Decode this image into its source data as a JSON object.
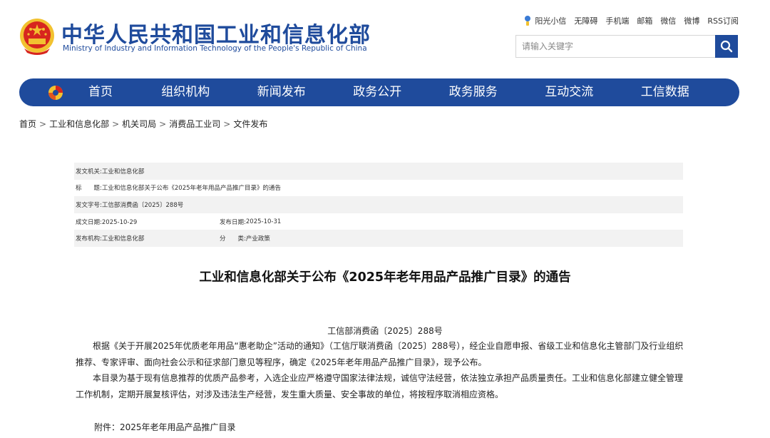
{
  "header": {
    "title": "中华人民共和国工业和信息化部",
    "subtitle": "Ministry of Industry and Information Technology of the People's Republic of China",
    "links": [
      "阳光小信",
      "无障碍",
      "手机端",
      "邮箱",
      "微信",
      "微博",
      "RSS订阅"
    ],
    "search_placeholder": "请输入关键字"
  },
  "nav": {
    "items": [
      "首页",
      "组织机构",
      "新闻发布",
      "政务公开",
      "政务服务",
      "互动交流",
      "工信数据"
    ]
  },
  "breadcrumb": [
    "首页",
    "工业和信息化部",
    "机关司局",
    "消费品工业司",
    "文件发布"
  ],
  "info": {
    "issuer_label": "发文机关:",
    "issuer": "工业和信息化部",
    "title_label": "标　　题:",
    "title": "工业和信息化部关于公布《2025年老年用品产品推广目录》的通告",
    "docnum_label": "发文字号:",
    "docnum": "工信部消费函〔2025〕288号",
    "created_label": "成文日期:",
    "created": "2025-10-29",
    "published_label": "发布日期:",
    "published": "2025-10-31",
    "org_label": "发布机构:",
    "org": "工业和信息化部",
    "category_label": "分　　类:",
    "category": "产业政策"
  },
  "article": {
    "title": "工业和信息化部关于公布《2025年老年用品产品推广目录》的通告",
    "doc_no": "工信部消费函〔2025〕288号",
    "para1": "根据《关于开展2025年优质老年用品“惠老助企”活动的通知》（工信厅联消费函〔2025〕288号），经企业自愿申报、省级工业和信息化主管部门及行业组织推荐、专家评审、面向社会公示和征求部门意见等程序，确定《2025年老年用品产品推广目录》，现予公布。",
    "para2": "本目录为基于现有信息推荐的优质产品参考，入选企业应严格遵守国家法律法规，诚信守法经营，依法独立承担产品质量责任。工业和信息化部建立健全管理工作机制，定期开展复核评估，对涉及违法生产经营，发生重大质量、安全事故的单位，将按程序取消相应资格。",
    "attachment": "附件：2025年老年用品产品推广目录"
  },
  "colors": {
    "brand": "#1f4b9c",
    "emblem_red": "#d7261e",
    "emblem_gold": "#f2c230"
  }
}
